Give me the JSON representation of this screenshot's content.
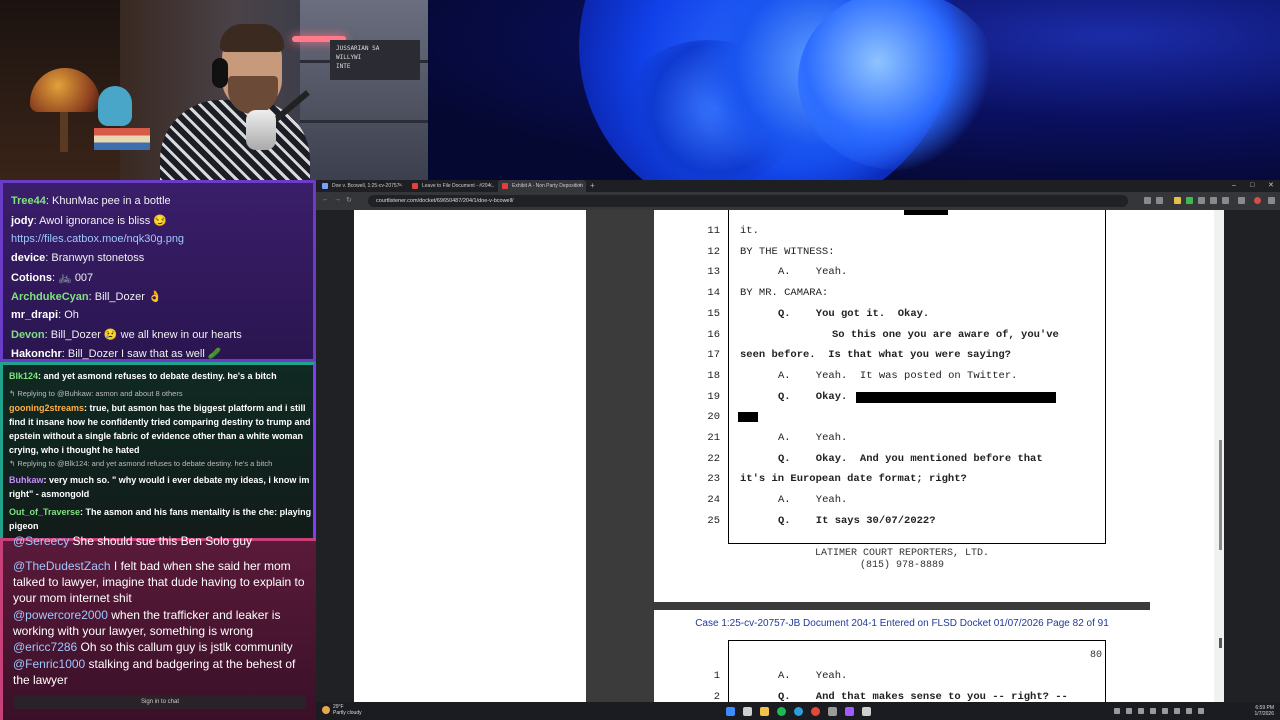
{
  "colors": {
    "chat_frame_purple": "#6a3cc8",
    "chat_frame_teal": "#1fa38a",
    "chat_frame_pink": "#c8407a",
    "case_header_blue": "#1f3a9a",
    "wallpaper_blue": "#1040e8"
  },
  "webcam": {
    "sign_text": "JUSSARIAN SA\nWILLYWI\nINTE"
  },
  "chat_section_1": [
    {
      "user": "Tree44",
      "color": "#7fe27f",
      "text": ": KhunMac pee in a bottle"
    },
    {
      "user": "jody",
      "color": "#ffffff",
      "text": ": Awol ignorance is bliss 😏"
    },
    {
      "user": "",
      "color": "#9ec8ff",
      "text": "https://files.catbox.moe/nqk30g.png"
    },
    {
      "user": "device",
      "color": "#ffffff",
      "text": ": Branwyn stonetoss"
    },
    {
      "user": "Cotions",
      "color": "#ffffff",
      "text": ": 🚲 007"
    },
    {
      "user": "ArchdukeCyan",
      "color": "#7fe27f",
      "text": ": Bill_Dozer 👌"
    },
    {
      "user": "mr_drapi",
      "color": "#ffffff",
      "text": ": Oh"
    },
    {
      "user": "Devon",
      "color": "#7fe27f",
      "text": ": Bill_Dozer 😢 we all knew in our hearts"
    },
    {
      "user": "Hakonchr",
      "color": "#ffffff",
      "text": ": Bill_Dozer I saw that as well 🥒"
    }
  ],
  "chat_section_2": {
    "m1_user": "Blk124",
    "m1_text": ": and yet asmond refuses to debate destiny. he's a bitch",
    "reply1": "↰ Replying to @Buhkaw: asmon and about 8 others",
    "m2_user": "gooning2streams",
    "m2_text": ": true, but asmon has the biggest platform and i still find it insane how he confidently tried comparing destiny to trump and epstein without a single fabric of evidence other than a white woman crying, who i thought he hated",
    "reply2": "↰ Replying to @Blk124: and yet asmond refuses to debate destiny. he's a bitch",
    "m3_user": "Buhkaw",
    "m3_text": ": very much so. \" why would i ever debate my ideas, i know im right\" - asmongold",
    "m4_user": "Out_of_Traverse",
    "m4_text": ": The asmon and his fans mentality is the che: playing pigeon"
  },
  "chat_section_3": [
    {
      "user": "@Sereecy",
      "text": " She should sue this Ben Solo guy"
    },
    {
      "user": "@TheDudestZach",
      "text": " I felt bad when she said her mom talked to lawyer, imagine that dude having to explain to your mom internet shit"
    },
    {
      "user": "@powercore2000",
      "text": " when the trafficker and leaker is working with your lawyer, something is wrong"
    },
    {
      "user": "@ericc7286",
      "text": " Oh so this callum guy is jstlk community"
    },
    {
      "user": "@Fenric1000",
      "text": " stalking and badgering at the behest of the lawyer"
    }
  ],
  "chat_signin": "Sign in to chat",
  "browser": {
    "tabs": [
      {
        "label": "Doe v. Bcowell, 1:25-cv-20757 - C",
        "icon_color": "#7aa0ff"
      },
      {
        "label": "Leave to File Document - #204...",
        "icon_color": "#e04040"
      },
      {
        "label": "Exhibit A - Non Party Deposition",
        "icon_color": "#e04040"
      }
    ],
    "new_tab": "+",
    "win_controls": [
      "–",
      "□",
      "✕"
    ],
    "url": "courtlistener.com/docket/69650487/204/1/doe-v-bcowell/",
    "back": "←",
    "forward": "→",
    "reload": "↻"
  },
  "pdf": {
    "page1_lines": [
      {
        "n": "11",
        "text": "it.",
        "indent": 0,
        "bold": false
      },
      {
        "n": "12",
        "text": "BY THE WITNESS:",
        "indent": 0,
        "bold": false
      },
      {
        "n": "13",
        "text": "A.    Yeah.",
        "indent": 38,
        "bold": false
      },
      {
        "n": "14",
        "text": "BY MR. CAMARA:",
        "indent": 0,
        "bold": false
      },
      {
        "n": "15",
        "text": "Q.    You got it.  Okay.",
        "indent": 38,
        "bold": true
      },
      {
        "n": "16",
        "text": "So this one you are aware of, you've",
        "indent": 92,
        "bold": true
      },
      {
        "n": "17",
        "text": "seen before.  Is that what you were saying?",
        "indent": 0,
        "bold": true
      },
      {
        "n": "18",
        "text": "A.    Yeah.  It was posted on Twitter.",
        "indent": 38,
        "bold": false
      },
      {
        "n": "19",
        "text": "Q.    Okay.",
        "indent": 38,
        "bold": true
      },
      {
        "n": "20",
        "text": "",
        "indent": 0,
        "bold": false
      },
      {
        "n": "21",
        "text": "A.    Yeah.",
        "indent": 38,
        "bold": false
      },
      {
        "n": "22",
        "text": "Q.    Okay.  And you mentioned before that",
        "indent": 38,
        "bold": true
      },
      {
        "n": "23",
        "text": "it's in European date format; right?",
        "indent": 0,
        "bold": true
      },
      {
        "n": "24",
        "text": "A.    Yeah.",
        "indent": 38,
        "bold": false
      },
      {
        "n": "25",
        "text": "Q.    It says 30/07/2022?",
        "indent": 38,
        "bold": true
      }
    ],
    "footer_line1": "LATIMER COURT REPORTERS, LTD.",
    "footer_line2": "(815) 978-8889",
    "case_header": "Case 1:25-cv-20757-JB   Document 204-1   Entered on FLSD Docket 01/07/2026   Page 82 of 91",
    "page2_number": "80",
    "page2_lines": [
      {
        "n": "1",
        "text": "A.    Yeah.",
        "indent": 38,
        "bold": false
      },
      {
        "n": "2",
        "text": "Q.    And that makes sense to you -- right? --",
        "indent": 38,
        "bold": true
      }
    ]
  },
  "taskbar": {
    "weather_temp": "29°F",
    "weather_desc": "Partly cloudy",
    "time": "6:59 PM",
    "date": "1/7/2026",
    "icons": [
      {
        "name": "start-icon",
        "color": "#3b8cff"
      },
      {
        "name": "search-icon",
        "color": "#cfcfcf"
      },
      {
        "name": "file-explorer-icon",
        "color": "#f2c14e"
      },
      {
        "name": "spotify-icon",
        "color": "#1db954"
      },
      {
        "name": "edge-icon",
        "color": "#2a9fd8"
      },
      {
        "name": "chrome-icon",
        "color": "#e04a3b"
      },
      {
        "name": "settings-icon",
        "color": "#9a9a9a"
      },
      {
        "name": "app-icon",
        "color": "#a05cff"
      },
      {
        "name": "obs-icon",
        "color": "#cfcfcf"
      }
    ]
  }
}
